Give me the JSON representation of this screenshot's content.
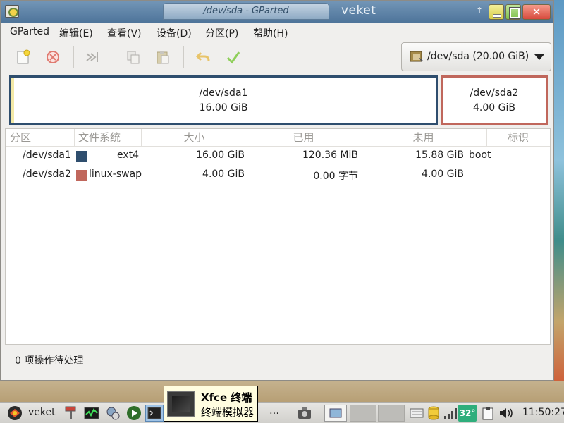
{
  "window": {
    "title": "/dev/sda - GParted",
    "host": "veket"
  },
  "menu": [
    "GParted",
    "编辑(E)",
    "查看(V)",
    "设备(D)",
    "分区(P)",
    "帮助(H)"
  ],
  "toolbar": {
    "icons": [
      "new-partition-icon",
      "delete-partition-icon",
      "resize-move-icon",
      "copy-icon",
      "paste-icon",
      "undo-icon",
      "apply-icon"
    ]
  },
  "device": {
    "label": "/dev/sda (20.00 GiB)"
  },
  "partition_graphic": [
    {
      "name": "/dev/sda1",
      "size": "16.00 GiB",
      "color": "#2f4e6e"
    },
    {
      "name": "/dev/sda2",
      "size": "4.00 GiB",
      "color": "#c0675c"
    }
  ],
  "table": {
    "headers": [
      "分区",
      "文件系统",
      "大小",
      "已用",
      "未用",
      "标识"
    ],
    "rows": [
      {
        "partition": "/dev/sda1",
        "filesystem": "ext4",
        "size": "16.00 GiB",
        "used": "120.36 MiB",
        "unused": "15.88 GiB",
        "flags": "boot",
        "color": "#2f4e6e"
      },
      {
        "partition": "/dev/sda2",
        "filesystem": "linux-swap",
        "size": "4.00 GiB",
        "used": "0.00 字节",
        "unused": "4.00 GiB",
        "flags": "",
        "color": "#c0675c"
      }
    ]
  },
  "status": {
    "text": "0 项操作待处理"
  },
  "taskbar": {
    "start_label": "veket",
    "ellipsis": "…",
    "temperature": "32°",
    "clock": "11:50:27"
  },
  "tooltip": {
    "title": "Xfce 终端",
    "subtitle": "终端模拟器"
  }
}
